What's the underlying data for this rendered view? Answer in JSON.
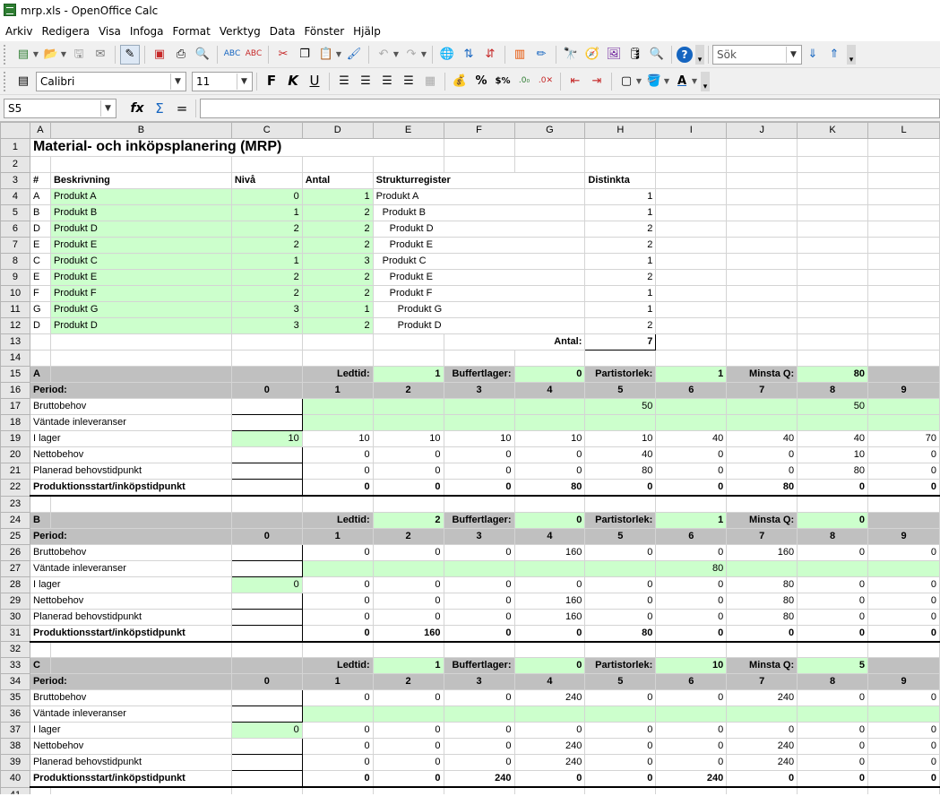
{
  "window": {
    "title": "mrp.xls - OpenOffice Calc"
  },
  "menu": [
    "Arkiv",
    "Redigera",
    "Visa",
    "Infoga",
    "Format",
    "Verktyg",
    "Data",
    "Fönster",
    "Hjälp"
  ],
  "toolbar": {
    "search_placeholder": "Sök"
  },
  "format": {
    "font": "Calibri",
    "size": "11"
  },
  "formula": {
    "cell_ref": "S5",
    "content": ""
  },
  "columns": [
    "A",
    "B",
    "C",
    "D",
    "E",
    "F",
    "G",
    "H",
    "I",
    "J",
    "K",
    "L"
  ],
  "sheet": {
    "title": "Material- och inköpsplanering (MRP)",
    "header": {
      "nr": "#",
      "desc": "Beskrivning",
      "level": "Nivå",
      "qty": "Antal",
      "struct": "Strukturregister",
      "distinct": "Distinkta"
    },
    "items": [
      {
        "id": "A",
        "desc": "Produkt A",
        "level": "0",
        "qty": "1",
        "struct": "Produkt A",
        "ind": 0,
        "distinct": "1"
      },
      {
        "id": "B",
        "desc": "Produkt B",
        "level": "1",
        "qty": "2",
        "struct": "Produkt B",
        "ind": 1,
        "distinct": "1"
      },
      {
        "id": "D",
        "desc": "Produkt D",
        "level": "2",
        "qty": "2",
        "struct": "Produkt D",
        "ind": 2,
        "distinct": "2"
      },
      {
        "id": "E",
        "desc": "Produkt E",
        "level": "2",
        "qty": "2",
        "struct": "Produkt E",
        "ind": 2,
        "distinct": "2"
      },
      {
        "id": "C",
        "desc": "Produkt C",
        "level": "1",
        "qty": "3",
        "struct": "Produkt C",
        "ind": 1,
        "distinct": "1"
      },
      {
        "id": "E",
        "desc": "Produkt E",
        "level": "2",
        "qty": "2",
        "struct": "Produkt E",
        "ind": 2,
        "distinct": "2"
      },
      {
        "id": "F",
        "desc": "Produkt F",
        "level": "2",
        "qty": "2",
        "struct": "Produkt F",
        "ind": 2,
        "distinct": "1"
      },
      {
        "id": "G",
        "desc": "Produkt G",
        "level": "3",
        "qty": "1",
        "struct": "Produkt G",
        "ind": 3,
        "distinct": "1"
      },
      {
        "id": "D",
        "desc": "Produkt D",
        "level": "3",
        "qty": "2",
        "struct": "Produkt D",
        "ind": 3,
        "distinct": "2"
      }
    ],
    "total_label": "Antal:",
    "total_value": "7",
    "labels": {
      "leadtime": "Ledtid:",
      "buffer": "Buffertlager:",
      "lotsize": "Partistorlek:",
      "minq": "Minsta Q:",
      "period": "Period:"
    },
    "rowlabels": [
      "Bruttobehov",
      "Väntade inleveranser",
      "I lager",
      "Nettobehov",
      "Planerad behovstidpunkt",
      "Produktionsstart/inköpstidpunkt"
    ],
    "periods": [
      "0",
      "1",
      "2",
      "3",
      "4",
      "5",
      "6",
      "7",
      "8",
      "9"
    ],
    "blocks": [
      {
        "id": "A",
        "leadtime": "1",
        "buffer": "0",
        "lotsize": "1",
        "minq": "80",
        "gross": [
          "",
          "",
          "",
          "",
          "",
          "50",
          "",
          "",
          "50",
          ""
        ],
        "sched": [
          "",
          "",
          "",
          "",
          "",
          "",
          "",
          "",
          "",
          ""
        ],
        "stock": [
          "10",
          "10",
          "10",
          "10",
          "10",
          "10",
          "40",
          "40",
          "40",
          "70"
        ],
        "net": [
          "",
          "0",
          "0",
          "0",
          "0",
          "40",
          "0",
          "0",
          "10",
          "0"
        ],
        "planned": [
          "",
          "0",
          "0",
          "0",
          "0",
          "80",
          "0",
          "0",
          "80",
          "0"
        ],
        "release": [
          "",
          "0",
          "0",
          "0",
          "80",
          "0",
          "0",
          "80",
          "0",
          "0"
        ]
      },
      {
        "id": "B",
        "leadtime": "2",
        "buffer": "0",
        "lotsize": "1",
        "minq": "0",
        "gross": [
          "",
          "0",
          "0",
          "0",
          "160",
          "0",
          "0",
          "160",
          "0",
          "0"
        ],
        "sched": [
          "",
          "",
          "",
          "",
          "",
          "",
          "80",
          "",
          "",
          ""
        ],
        "stock": [
          "0",
          "0",
          "0",
          "0",
          "0",
          "0",
          "0",
          "80",
          "0",
          "0"
        ],
        "net": [
          "",
          "0",
          "0",
          "0",
          "160",
          "0",
          "0",
          "80",
          "0",
          "0"
        ],
        "planned": [
          "",
          "0",
          "0",
          "0",
          "160",
          "0",
          "0",
          "80",
          "0",
          "0"
        ],
        "release": [
          "",
          "0",
          "160",
          "0",
          "0",
          "80",
          "0",
          "0",
          "0",
          "0"
        ]
      },
      {
        "id": "C",
        "leadtime": "1",
        "buffer": "0",
        "lotsize": "10",
        "minq": "5",
        "gross": [
          "",
          "0",
          "0",
          "0",
          "240",
          "0",
          "0",
          "240",
          "0",
          "0"
        ],
        "sched": [
          "",
          "",
          "",
          "",
          "",
          "",
          "",
          "",
          "",
          ""
        ],
        "stock": [
          "0",
          "0",
          "0",
          "0",
          "0",
          "0",
          "0",
          "0",
          "0",
          "0"
        ],
        "net": [
          "",
          "0",
          "0",
          "0",
          "240",
          "0",
          "0",
          "240",
          "0",
          "0"
        ],
        "planned": [
          "",
          "0",
          "0",
          "0",
          "240",
          "0",
          "0",
          "240",
          "0",
          "0"
        ],
        "release": [
          "",
          "0",
          "0",
          "240",
          "0",
          "0",
          "240",
          "0",
          "0",
          "0"
        ]
      }
    ]
  }
}
